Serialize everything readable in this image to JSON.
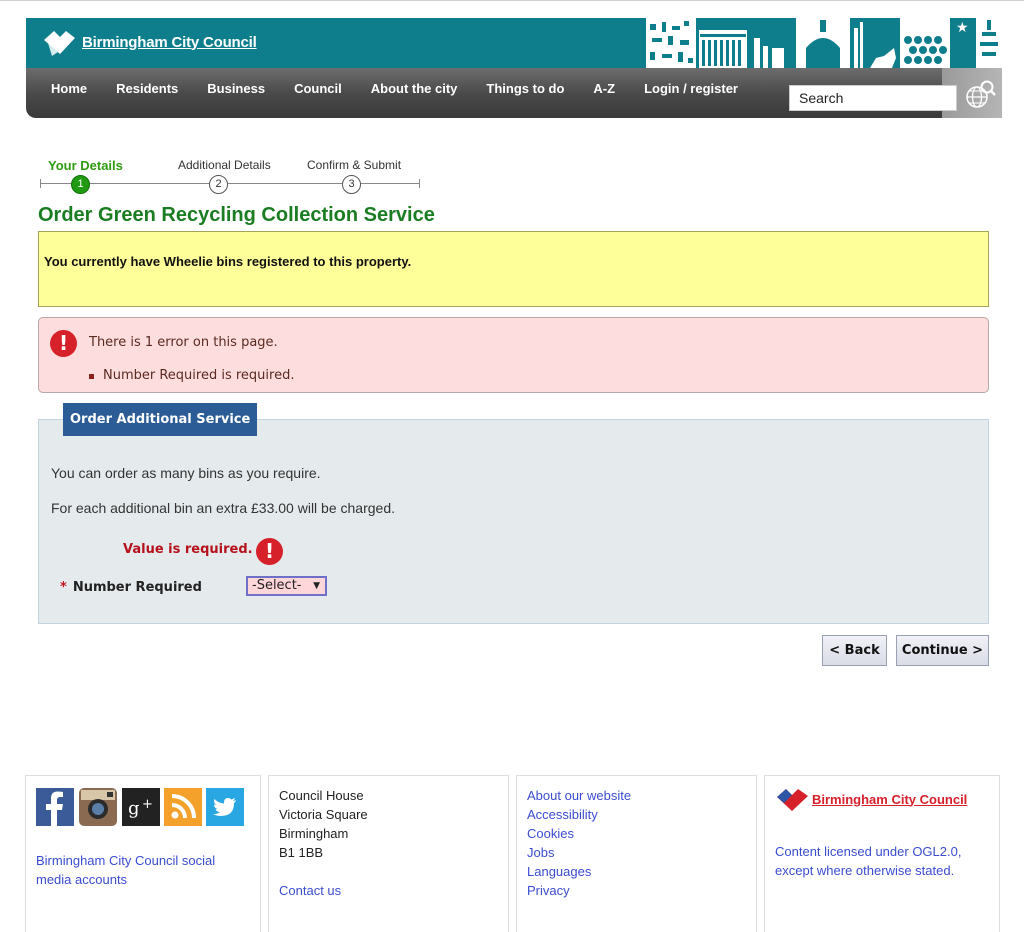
{
  "header": {
    "logo_text": "Birmingham City Council",
    "nav": [
      "Home",
      "Residents",
      "Business",
      "Council",
      "About the city",
      "Things to do",
      "A-Z",
      "Login / register"
    ],
    "search_placeholder": "Search"
  },
  "steps": [
    {
      "label": "Your Details",
      "number": "1"
    },
    {
      "label": "Additional Details",
      "number": "2"
    },
    {
      "label": "Confirm & Submit",
      "number": "3"
    }
  ],
  "page_title": "Order Green Recycling Collection Service",
  "info_message": "You currently have Wheelie bins registered to this property.",
  "errors": {
    "summary": "There is 1 error on this page.",
    "items": [
      "Number Required is required."
    ]
  },
  "form": {
    "section_title": "Order Additional Service",
    "intro_1": "You can order as many bins as you require.",
    "intro_2": "For each additional bin an extra £33.00 will be charged.",
    "field_error": "Value is required.",
    "field_required_mark": "*",
    "field_label": "Number Required",
    "select_value": "-Select-"
  },
  "buttons": {
    "back": "< Back",
    "continue": "Continue >"
  },
  "footer": {
    "social_text": [
      "Birmingham City Council social",
      "media accounts"
    ],
    "address": [
      "Council House",
      "Victoria Square",
      "Birmingham",
      "B1 1BB"
    ],
    "contact": "Contact us",
    "links": [
      "About our website",
      "Accessibility",
      "Cookies",
      "Jobs",
      "Languages",
      "Privacy"
    ],
    "logo_text": "Birmingham City Council",
    "license": [
      "Content licensed under OGL2.0,",
      "except where otherwise stated."
    ]
  },
  "colors": {
    "brand_teal": "#0e7e8c",
    "title_green": "#1b7d22",
    "info_yellow": "#ffff99",
    "error_pink": "#fddddd",
    "tab_blue": "#2c5c95",
    "link_blue": "#3a4dd0"
  }
}
